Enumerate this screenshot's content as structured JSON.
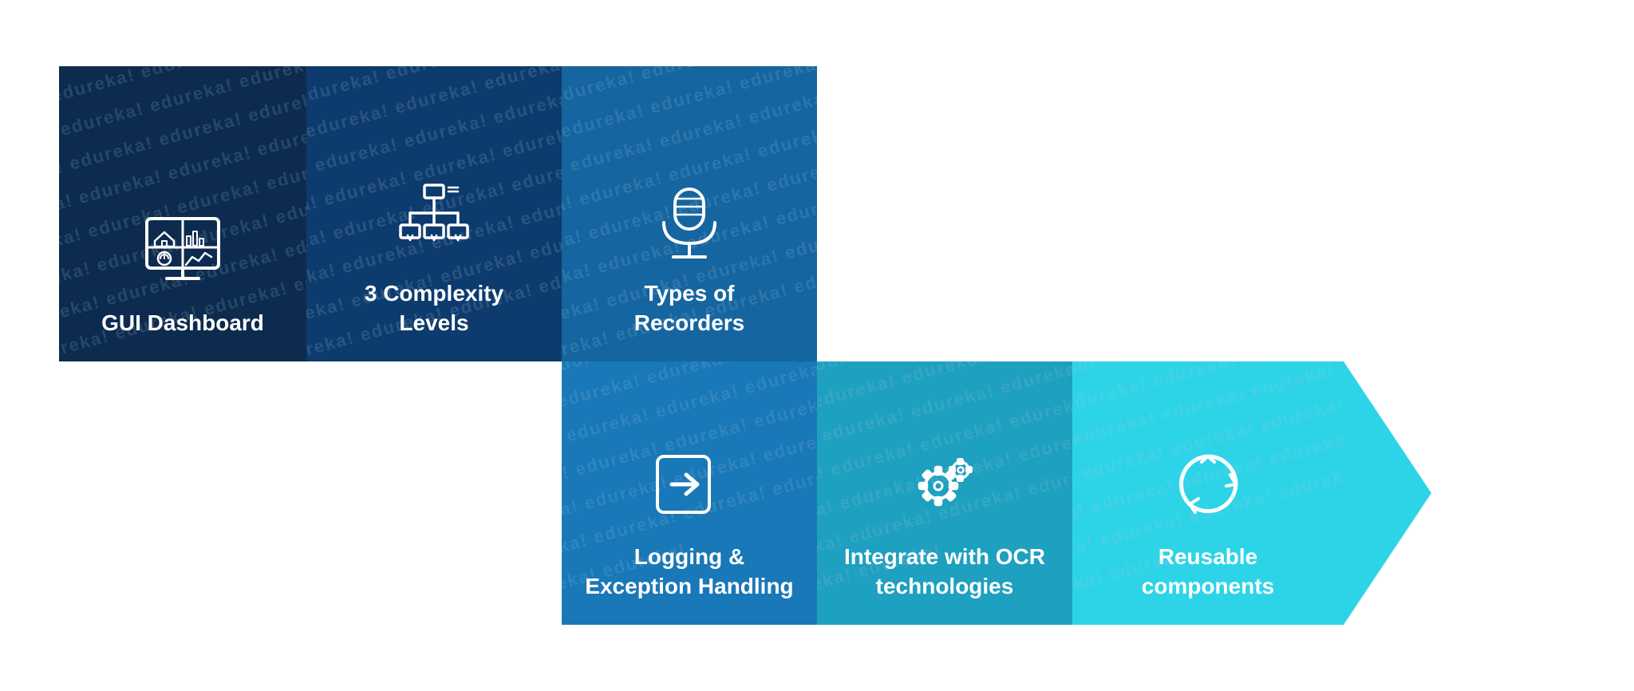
{
  "watermark_text": "edureka! edureka! edureka! edureka! edureka! edureka! edureka! edureka! edureka! edureka! edureka! edureka! edureka! edureka! edureka! edureka! edureka! edureka! edureka! edureka! edureka! edureka! edureka! edureka! edureka! edureka! edureka! edureka! edureka! edureka! edureka! edureka! edureka! edureka! edureka! edureka! edureka! edureka! edureka! edureka! edureka! edureka! edureka! edureka! edureka!",
  "cells": {
    "cell1": {
      "label": "GUI\nDashboard",
      "icon": "dashboard"
    },
    "cell2": {
      "label": "3 Complexity\nLevels",
      "icon": "hierarchy"
    },
    "cell3": {
      "label": "Types of\nRecorders",
      "icon": "microphone"
    },
    "cell4": {
      "label": "Logging &\nException Handling",
      "icon": "login-arrow"
    },
    "cell5": {
      "label": "Integrate with OCR\ntechnologies",
      "icon": "gears"
    },
    "cell6": {
      "label": "Reusable\ncomponents",
      "icon": "recycle"
    }
  }
}
